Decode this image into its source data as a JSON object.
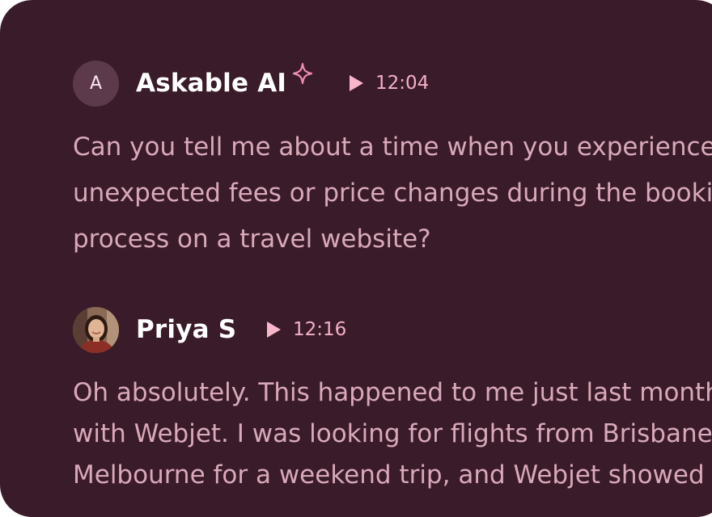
{
  "messages": [
    {
      "sender": "Askable AI",
      "avatar_letter": "A",
      "timestamp": "12:04",
      "lines": [
        "Can you tell me about a time when you experienced",
        "unexpected fees or price changes during the booking",
        "process on a travel website?"
      ]
    },
    {
      "sender": "Priya S",
      "timestamp": "12:16",
      "lines": [
        "Oh absolutely. This happened to me just last month",
        "with Webjet. I was looking for flights from Brisbane to",
        "Melbourne for a weekend trip, and Webjet showed"
      ]
    }
  ],
  "colors": {
    "background": "#3a1b29",
    "name": "#ffffff",
    "body_text": "#d9a9b9",
    "accent": "#f3b0c6"
  },
  "icons": {
    "ai_badge": "sparkle-icon",
    "timestamp": "play-icon"
  }
}
